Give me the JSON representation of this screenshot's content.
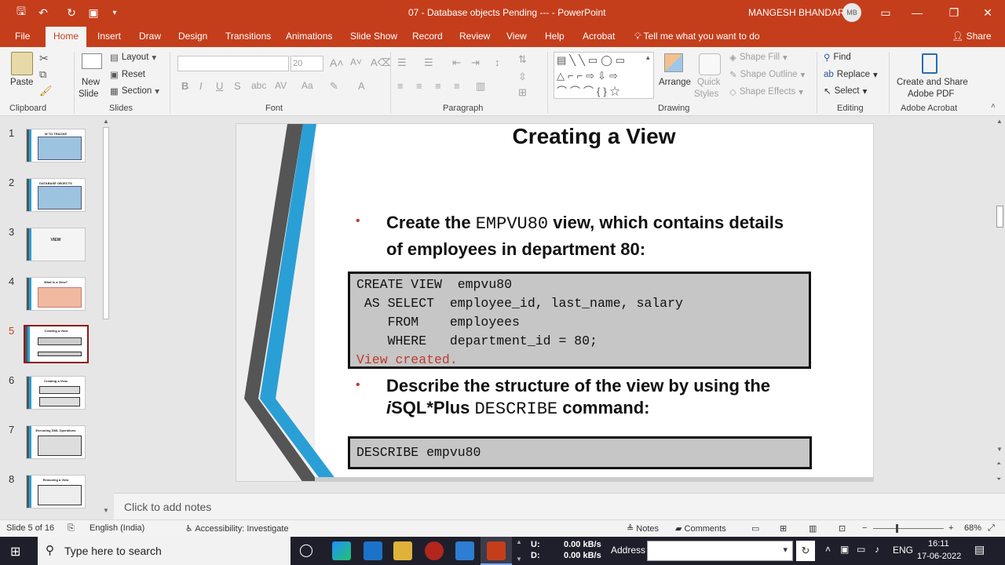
{
  "titlebar": {
    "doc_title": "07 - Database objects Pending ---  -  PowerPoint",
    "user": "MANGESH BHANDARI",
    "avatar_initials": "MB"
  },
  "tabs": [
    "File",
    "Home",
    "Insert",
    "Draw",
    "Design",
    "Transitions",
    "Animations",
    "Slide Show",
    "Record",
    "Review",
    "View",
    "Help",
    "Acrobat"
  ],
  "active_tab": "Home",
  "tellme": "Tell me what you want to do",
  "share": "Share",
  "ribbon": {
    "clipboard": {
      "label": "Clipboard",
      "paste": "Paste"
    },
    "slides": {
      "label": "Slides",
      "new_slide_1": "New",
      "new_slide_2": "Slide",
      "layout": "Layout",
      "reset": "Reset",
      "section": "Section"
    },
    "font": {
      "label": "Font",
      "font_name": "",
      "font_size": "20"
    },
    "paragraph": {
      "label": "Paragraph"
    },
    "drawing": {
      "label": "Drawing",
      "arrange": "Arrange",
      "quick_styles_1": "Quick",
      "quick_styles_2": "Styles",
      "shape_fill": "Shape Fill",
      "shape_outline": "Shape Outline",
      "shape_effects": "Shape Effects"
    },
    "editing": {
      "label": "Editing",
      "find": "Find",
      "replace": "Replace",
      "select": "Select"
    },
    "acrobat": {
      "label": "Adobe Acrobat",
      "create_1": "Create and Share",
      "create_2": "Adobe PDF"
    }
  },
  "thumbnails": [
    {
      "num": "1",
      "title": "W TO TRACKE"
    },
    {
      "num": "2",
      "title": "DATABASE OBJECTS"
    },
    {
      "num": "3",
      "title": "VIEW"
    },
    {
      "num": "4",
      "title": "What is a View?"
    },
    {
      "num": "5",
      "title": "Creating a View"
    },
    {
      "num": "6",
      "title": "Creating a View"
    },
    {
      "num": "7",
      "title": "Executing DML Operations"
    },
    {
      "num": "8",
      "title": "Removing a View"
    }
  ],
  "selected_slide": "5",
  "slide": {
    "title": "Creating a View",
    "bullet1_a": "Create the ",
    "bullet1_code": "EMPVU80",
    "bullet1_b": " view, which contains details",
    "bullet1_c": "of employees in department 80:",
    "code1": [
      "CREATE VIEW  empvu80",
      " AS SELECT  employee_id, last_name, salary",
      "    FROM    employees",
      "    WHERE   department_id = 80;"
    ],
    "code1_result": "View created.",
    "bullet2_a": "Describe the structure of the view by using the",
    "bullet2_i": "i",
    "bullet2_b": "SQL*Plus ",
    "bullet2_code": "DESCRIBE",
    "bullet2_c": " command:",
    "code2": "DESCRIBE empvu80"
  },
  "notes_placeholder": "Click to add notes",
  "status": {
    "slide_of": "Slide 5 of 16",
    "language": "English (India)",
    "accessibility": "Accessibility: Investigate",
    "notes": "Notes",
    "comments": "Comments",
    "zoom": "68%"
  },
  "taskbar": {
    "search": "Type here to search",
    "upload_label": "U:",
    "download_label": "D:",
    "upload": "0.00 kB/s",
    "download": "0.00 kB/s",
    "address": "Address",
    "lang": "ENG",
    "time": "16:11",
    "date": "17-06-2022"
  },
  "colors": {
    "accent": "#c43e1c",
    "selected_border": "#8b1a1a",
    "bullet_red": "#c0392b"
  }
}
